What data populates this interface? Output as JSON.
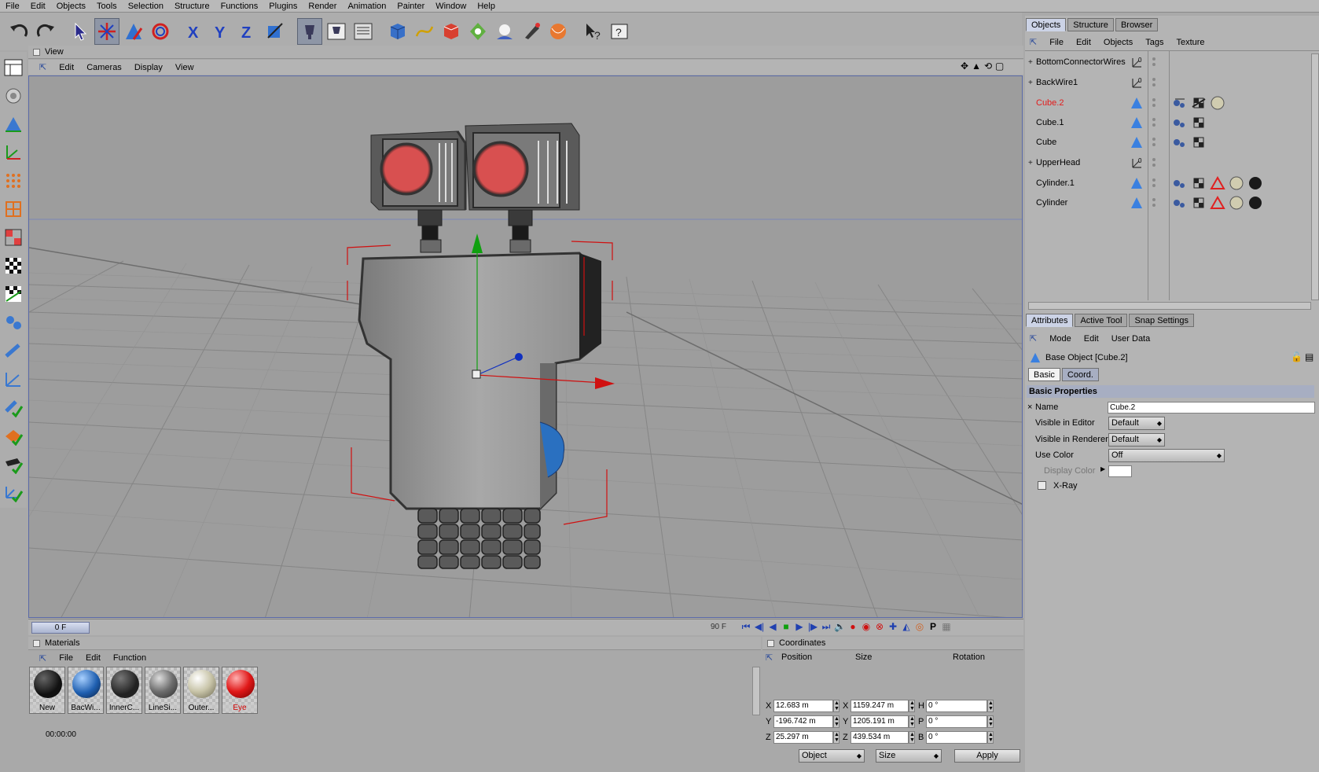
{
  "menubar": [
    "File",
    "Edit",
    "Objects",
    "Tools",
    "Selection",
    "Structure",
    "Functions",
    "Plugins",
    "Render",
    "Animation",
    "Painter",
    "Window",
    "Help"
  ],
  "viewport": {
    "title": "View",
    "menu": [
      "Edit",
      "Cameras",
      "Display",
      "View"
    ]
  },
  "timeline": {
    "current_frame": "0 F",
    "end_frame": "90 F"
  },
  "materials": {
    "title": "Materials",
    "menu": [
      "File",
      "Edit",
      "Function"
    ],
    "items": [
      {
        "label": "New",
        "color": "#1a1a1a"
      },
      {
        "label": "BacWi...",
        "color": "#1f5fb0"
      },
      {
        "label": "InnerC...",
        "color": "#222222"
      },
      {
        "label": "LineSi...",
        "color": "#6e6e6e"
      },
      {
        "label": "Outer...",
        "color": "#c8c4a8"
      },
      {
        "label": "Eye",
        "color": "#e01818"
      }
    ]
  },
  "status": {
    "time": "00:00:00"
  },
  "coordinates": {
    "title": "Coordinates",
    "columns": [
      "Position",
      "Size",
      "Rotation"
    ],
    "rows": [
      {
        "axis": "X",
        "position": "12.683 m",
        "size_axis": "X",
        "size": "1159.247 m",
        "rot_axis": "H",
        "rotation": "0 °"
      },
      {
        "axis": "Y",
        "position": "-196.742 m",
        "size_axis": "Y",
        "size": "1205.191 m",
        "rot_axis": "P",
        "rotation": "0 °"
      },
      {
        "axis": "Z",
        "position": "25.297 m",
        "size_axis": "Z",
        "size": "439.534 m",
        "rot_axis": "B",
        "rotation": "0 °"
      }
    ],
    "mode_select": "Object",
    "size_select": "Size",
    "apply_label": "Apply"
  },
  "objects_panel": {
    "tabs": [
      "Objects",
      "Structure",
      "Browser"
    ],
    "menu": [
      "File",
      "Edit",
      "Objects",
      "Tags",
      "Texture"
    ],
    "items": [
      {
        "name": "BottomConnectorWires",
        "expandable": true,
        "type": "null",
        "selected": false,
        "tags": []
      },
      {
        "name": "BackWire1",
        "expandable": true,
        "type": "null",
        "selected": false,
        "tags": []
      },
      {
        "name": "Cube.2",
        "expandable": false,
        "type": "poly",
        "selected": true,
        "tags": [
          "phong",
          "uvw",
          "material-sphere"
        ]
      },
      {
        "name": "Cube.1",
        "expandable": false,
        "type": "poly",
        "selected": false,
        "tags": [
          "phong",
          "uvw"
        ]
      },
      {
        "name": "Cube",
        "expandable": false,
        "type": "poly",
        "selected": false,
        "tags": [
          "phong",
          "uvw"
        ]
      },
      {
        "name": "UpperHead",
        "expandable": true,
        "type": "null",
        "selected": false,
        "tags": []
      },
      {
        "name": "Cylinder.1",
        "expandable": false,
        "type": "poly",
        "selected": false,
        "tags": [
          "phong",
          "uvw",
          "warning",
          "material-sphere",
          "material-dark"
        ]
      },
      {
        "name": "Cylinder",
        "expandable": false,
        "type": "poly",
        "selected": false,
        "tags": [
          "phong",
          "uvw",
          "warning",
          "material-sphere",
          "material-dark"
        ]
      }
    ]
  },
  "attributes_panel": {
    "tabs": [
      "Attributes",
      "Active Tool",
      "Snap Settings"
    ],
    "menu": [
      "Mode",
      "Edit",
      "User Data"
    ],
    "object_title": "Base Object [Cube.2]",
    "subtabs": [
      "Basic",
      "Coord."
    ],
    "section": "Basic Properties",
    "fields": {
      "name_label": "Name",
      "name_value": "Cube.2",
      "vis_editor_label": "Visible in Editor",
      "vis_editor_value": "Default",
      "vis_render_label": "Visible in Renderer",
      "vis_render_value": "Default",
      "use_color_label": "Use Color",
      "use_color_value": "Off",
      "display_color_label": "Display Color",
      "xray_label": "X-Ray"
    }
  },
  "colors": {
    "accent_selection": "#e21b1b",
    "viewport_bg": "#9d9d9d",
    "panel_bg": "#b4b4b4",
    "axis_x": "#d01010",
    "axis_y": "#10a010",
    "axis_z": "#1030c0",
    "robot_eye": "#d85050"
  }
}
